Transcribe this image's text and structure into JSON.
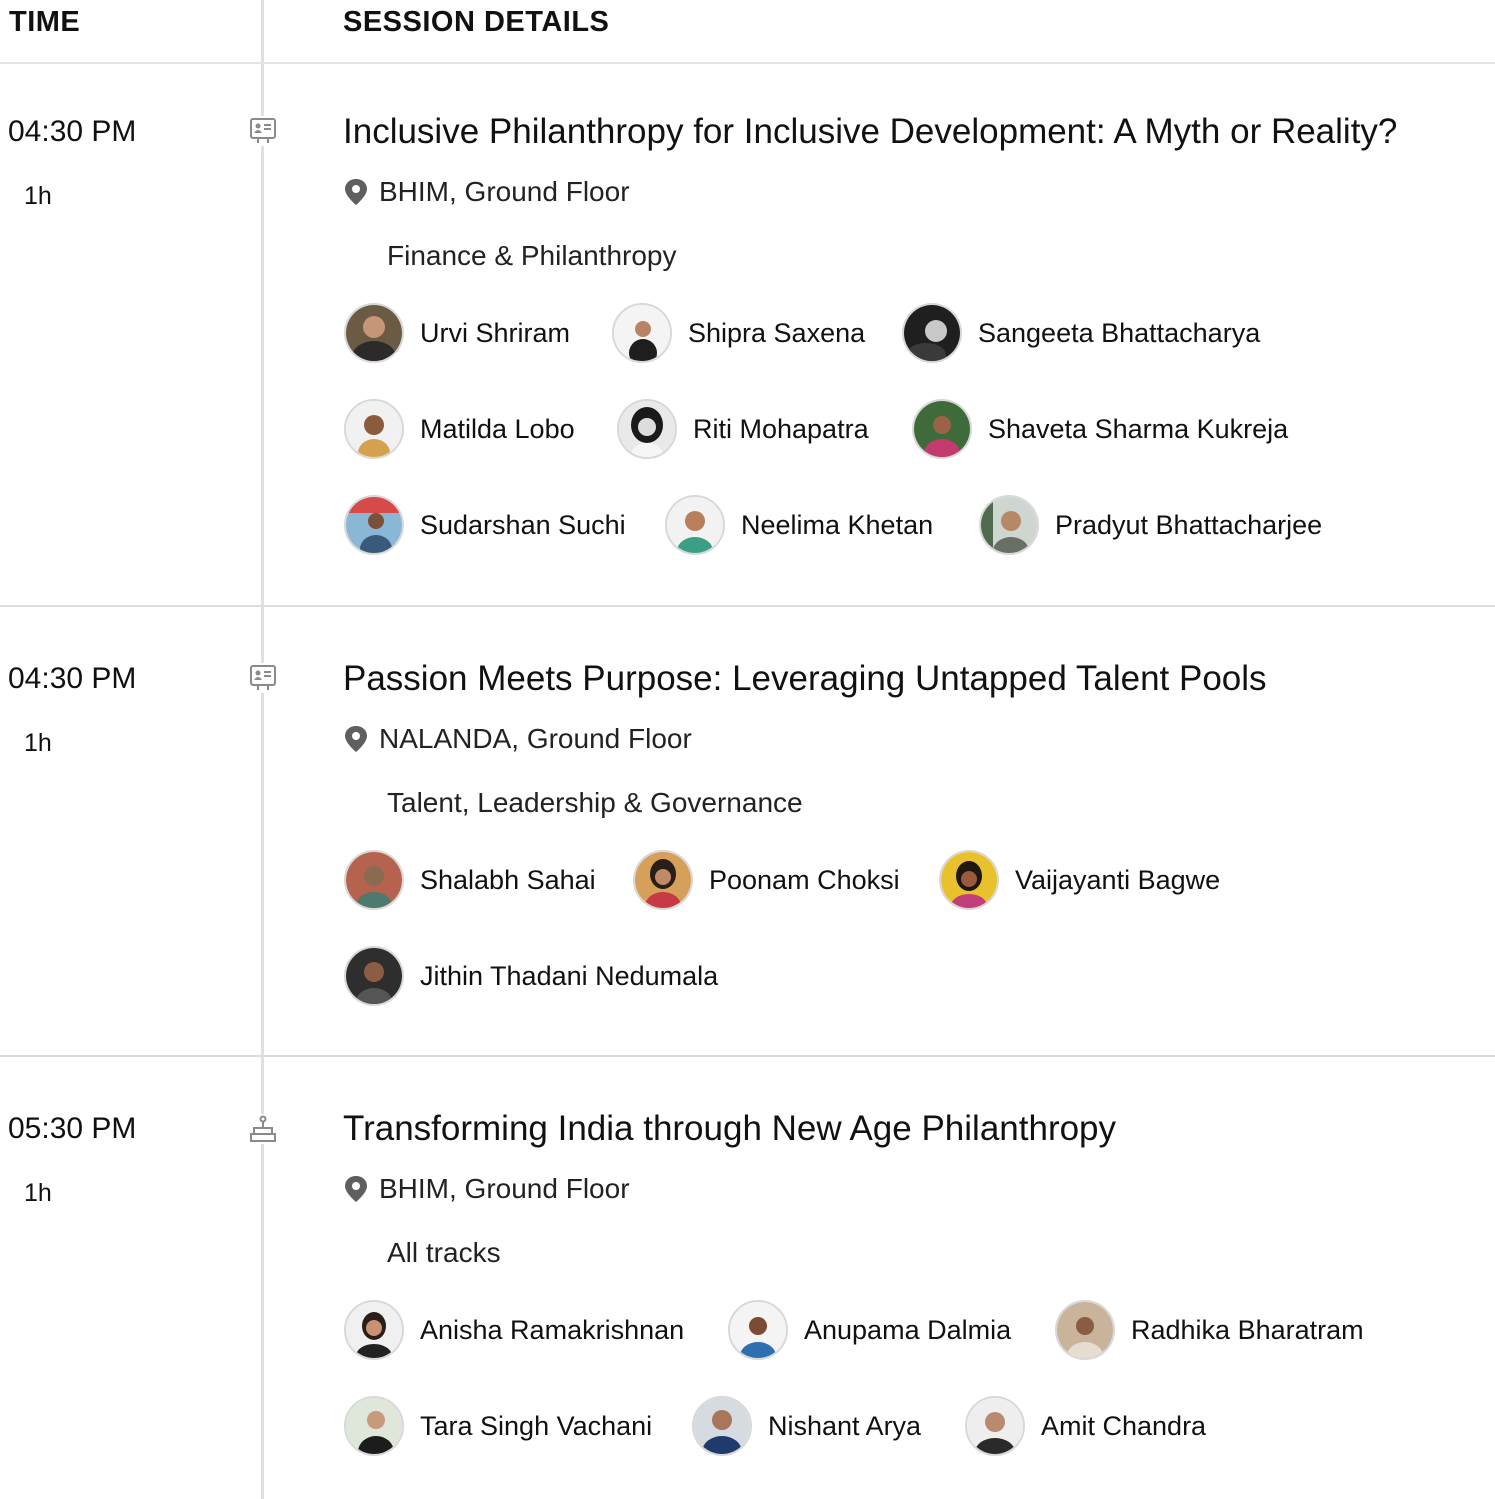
{
  "header": {
    "time_label": "TIME",
    "details_label": "SESSION DETAILS"
  },
  "sessions": [
    {
      "time": "04:30 PM",
      "duration": "1h",
      "icon": "presentation-icon",
      "title": "Inclusive Philanthropy for Inclusive Development: A Myth or Reality?",
      "location": "BHIM, Ground Floor",
      "track": "Finance & Philanthropy",
      "speakers": [
        "Urvi Shriram",
        "Shipra Saxena",
        "Sangeeta Bhattacharya",
        "Matilda Lobo",
        "Riti Mohapatra",
        "Shaveta Sharma Kukreja",
        "Sudarshan Suchi",
        "Neelima Khetan",
        "Pradyut Bhattacharjee"
      ]
    },
    {
      "time": "04:30 PM",
      "duration": "1h",
      "icon": "presentation-icon",
      "title": "Passion Meets Purpose: Leveraging Untapped Talent Pools",
      "location": "NALANDA, Ground Floor",
      "track": "Talent, Leadership & Governance",
      "speakers": [
        "Shalabh Sahai",
        "Poonam Choksi",
        "Vaijayanti Bagwe",
        "Jithin Thadani Nedumala"
      ]
    },
    {
      "time": "05:30 PM",
      "duration": "1h",
      "icon": "podium-icon",
      "title": "Transforming India through New Age Philanthropy",
      "location": "BHIM, Ground Floor",
      "track": "All tracks",
      "speakers": [
        "Anisha Ramakrishnan",
        "Anupama Dalmia",
        "Radhika Bharatram",
        "Tara Singh Vachani",
        "Nishant Arya",
        "Amit Chandra"
      ]
    }
  ]
}
